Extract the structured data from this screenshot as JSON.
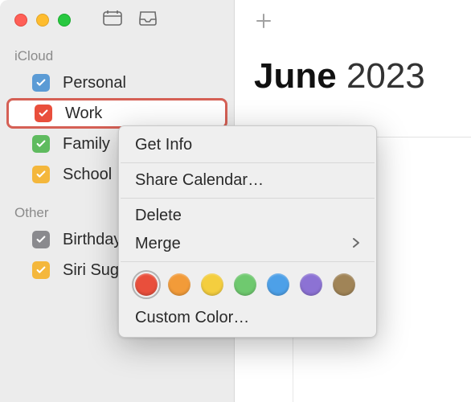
{
  "sidebar": {
    "sections": [
      {
        "title": "iCloud",
        "items": [
          {
            "label": "Personal",
            "color": "#5b9bd5",
            "selected": false
          },
          {
            "label": "Work",
            "color": "#e94f3c",
            "selected": true
          },
          {
            "label": "Family",
            "color": "#5fbb5f",
            "selected": false
          },
          {
            "label": "School",
            "color": "#f4b73c",
            "selected": false
          }
        ]
      },
      {
        "title": "Other",
        "items": [
          {
            "label": "Birthdays",
            "color": "#8a8a8e",
            "selected": false
          },
          {
            "label": "Siri Suggestions",
            "color": "#f4b73c",
            "selected": false
          }
        ]
      }
    ]
  },
  "main": {
    "month": "June",
    "year": "2023"
  },
  "context_menu": {
    "get_info": "Get Info",
    "share": "Share Calendar…",
    "delete": "Delete",
    "merge": "Merge",
    "custom_color": "Custom Color…",
    "colors": [
      "#e94f3c",
      "#f29b39",
      "#f4ce3f",
      "#6fc96f",
      "#4da0e8",
      "#8c72d4",
      "#a08457"
    ]
  }
}
